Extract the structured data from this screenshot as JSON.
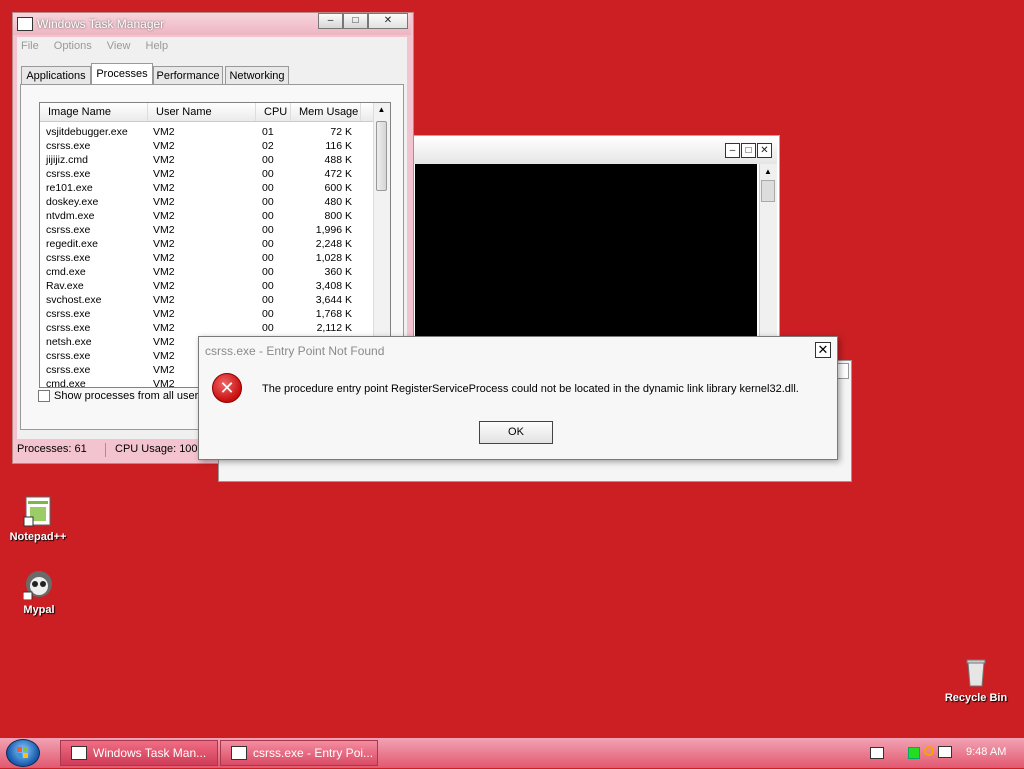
{
  "desktop": {
    "icons": [
      {
        "label": "Notepad++",
        "icon": "notepadpp-icon"
      },
      {
        "label": "Mypal",
        "icon": "mypal-icon"
      },
      {
        "label": "Recycle Bin",
        "icon": "recycle-bin-icon"
      }
    ]
  },
  "task_manager": {
    "title": "Windows Task Manager",
    "menu": [
      "File",
      "Options",
      "View",
      "Help"
    ],
    "tabs": [
      "Applications",
      "Processes",
      "Performance",
      "Networking"
    ],
    "active_tab": "Processes",
    "columns": [
      "Image Name",
      "User Name",
      "CPU",
      "Mem Usage"
    ],
    "rows": [
      {
        "image": "vsjitdebugger.exe",
        "user": "VM2",
        "cpu": "01",
        "mem": "72 K"
      },
      {
        "image": "csrss.exe",
        "user": "VM2",
        "cpu": "02",
        "mem": "116 K"
      },
      {
        "image": "jijijiz.cmd",
        "user": "VM2",
        "cpu": "00",
        "mem": "488 K"
      },
      {
        "image": "csrss.exe",
        "user": "VM2",
        "cpu": "00",
        "mem": "472 K"
      },
      {
        "image": "re101.exe",
        "user": "VM2",
        "cpu": "00",
        "mem": "600 K"
      },
      {
        "image": "doskey.exe",
        "user": "VM2",
        "cpu": "00",
        "mem": "480 K"
      },
      {
        "image": "ntvdm.exe",
        "user": "VM2",
        "cpu": "00",
        "mem": "800 K"
      },
      {
        "image": "csrss.exe",
        "user": "VM2",
        "cpu": "00",
        "mem": "1,996 K"
      },
      {
        "image": "regedit.exe",
        "user": "VM2",
        "cpu": "00",
        "mem": "2,248 K"
      },
      {
        "image": "csrss.exe",
        "user": "VM2",
        "cpu": "00",
        "mem": "1,028 K"
      },
      {
        "image": "cmd.exe",
        "user": "VM2",
        "cpu": "00",
        "mem": "360 K"
      },
      {
        "image": "Rav.exe",
        "user": "VM2",
        "cpu": "00",
        "mem": "3,408 K"
      },
      {
        "image": "svchost.exe",
        "user": "VM2",
        "cpu": "00",
        "mem": "3,644 K"
      },
      {
        "image": "csrss.exe",
        "user": "VM2",
        "cpu": "00",
        "mem": "1,768 K"
      },
      {
        "image": "csrss.exe",
        "user": "VM2",
        "cpu": "00",
        "mem": "2,112 K"
      },
      {
        "image": "netsh.exe",
        "user": "VM2",
        "cpu": "",
        "mem": ""
      },
      {
        "image": "csrss.exe",
        "user": "VM2",
        "cpu": "",
        "mem": ""
      },
      {
        "image": "csrss.exe",
        "user": "VM2",
        "cpu": "",
        "mem": ""
      },
      {
        "image": "cmd.exe",
        "user": "VM2",
        "cpu": "",
        "mem": ""
      }
    ],
    "show_all_label": "Show processes from all users",
    "status": {
      "processes": "Processes: 61",
      "cpu": "CPU Usage: 100%"
    }
  },
  "dialog": {
    "title": "csrss.exe - Entry Point Not Found",
    "message": "The procedure entry point RegisterServiceProcess could not be located in the dynamic link library kernel32.dll.",
    "ok_label": "OK",
    "close_label": "✕"
  },
  "taskbar": {
    "buttons": [
      "Windows Task Man...",
      "csrss.exe - Entry Poi..."
    ],
    "clock": "9:48 AM"
  },
  "colors": {
    "desktop": "#cc1f24",
    "taskbar": "#e2586f",
    "error": "#c80e0e"
  }
}
